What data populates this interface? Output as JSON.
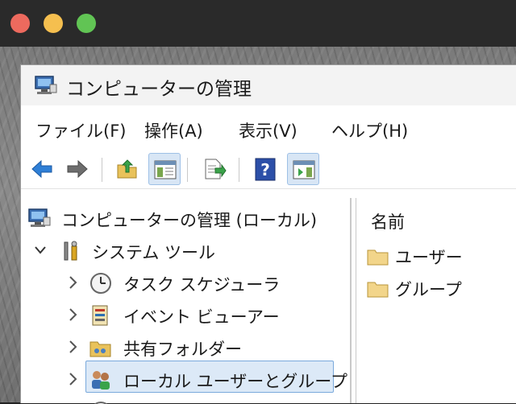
{
  "window": {
    "title": "コンピューターの管理",
    "title_icon": "computer-management-icon"
  },
  "menu": [
    "ファイル(F)",
    "操作(A)",
    "表示(V)",
    "ヘルプ(H)"
  ],
  "toolbar": {
    "buttons": [
      "back-arrow-icon",
      "forward-arrow-icon",
      "up-folder-icon",
      "show-hide-console-tree-icon",
      "export-list-icon",
      "help-icon",
      "show-action-pane-icon"
    ]
  },
  "tree": {
    "root": "コンピューターの管理 (ローカル)",
    "system_tools": "システム ツール",
    "items": [
      "タスク スケジューラ",
      "イベント ビューアー",
      "共有フォルダー",
      "ローカル ユーザーとグループ"
    ],
    "selected": "ローカル ユーザーとグループ"
  },
  "list": {
    "column_header": "名前",
    "items": [
      "ユーザー",
      "グループ"
    ]
  },
  "colors": {
    "selection_bg": "#dce9f7",
    "selection_border": "#7aa9dc",
    "back_arrow": "#2f7fd6"
  }
}
